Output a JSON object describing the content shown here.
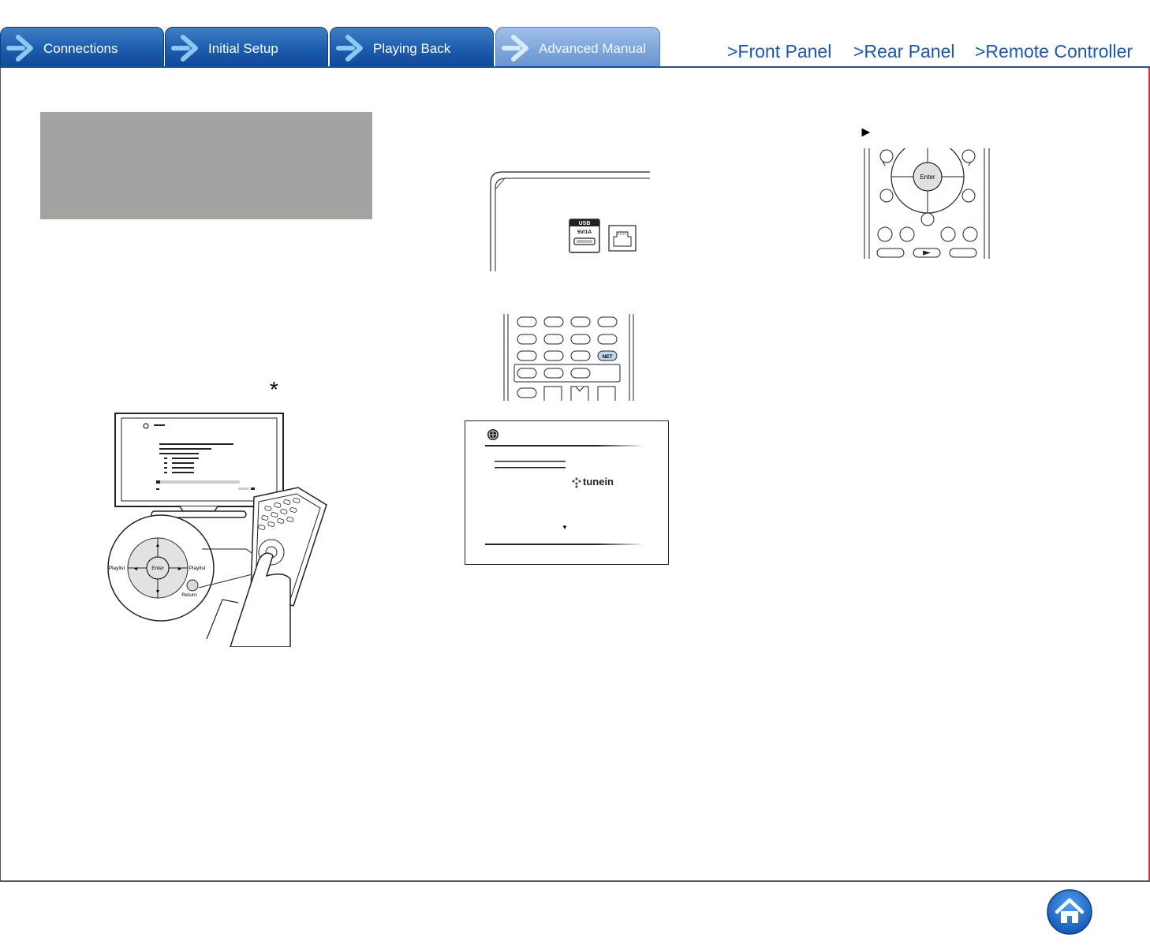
{
  "tabs": [
    {
      "label": "Connections"
    },
    {
      "label": "Initial Setup"
    },
    {
      "label": "Playing Back"
    },
    {
      "label": "Advanced Manual"
    }
  ],
  "links": {
    "front_panel": ">Front Panel",
    "rear_panel": ">Rear Panel",
    "remote_controller": ">Remote Controller"
  },
  "asterisk": "*",
  "play_mark": "►",
  "remote_closeup": {
    "enter": "Enter",
    "playlist_left": "Playlist",
    "playlist_right": "Playlist",
    "return": "Return"
  },
  "usb_port": {
    "label": "USB",
    "rating": "5V/1A"
  },
  "net_button": "NET",
  "tunein_logo": "tunein",
  "enter_small": "Enter",
  "colors": {
    "tab_blue": "#1f5fb0",
    "tab_active": "#7ea7dc",
    "link_blue": "#1a57b8",
    "frame_red": "#d4364a",
    "gray_box": "#a3a3a2",
    "home_blue": "#1c6fd0"
  },
  "icons": {
    "tab_arrow": "chevron-arrow-icon",
    "home": "home-icon"
  }
}
